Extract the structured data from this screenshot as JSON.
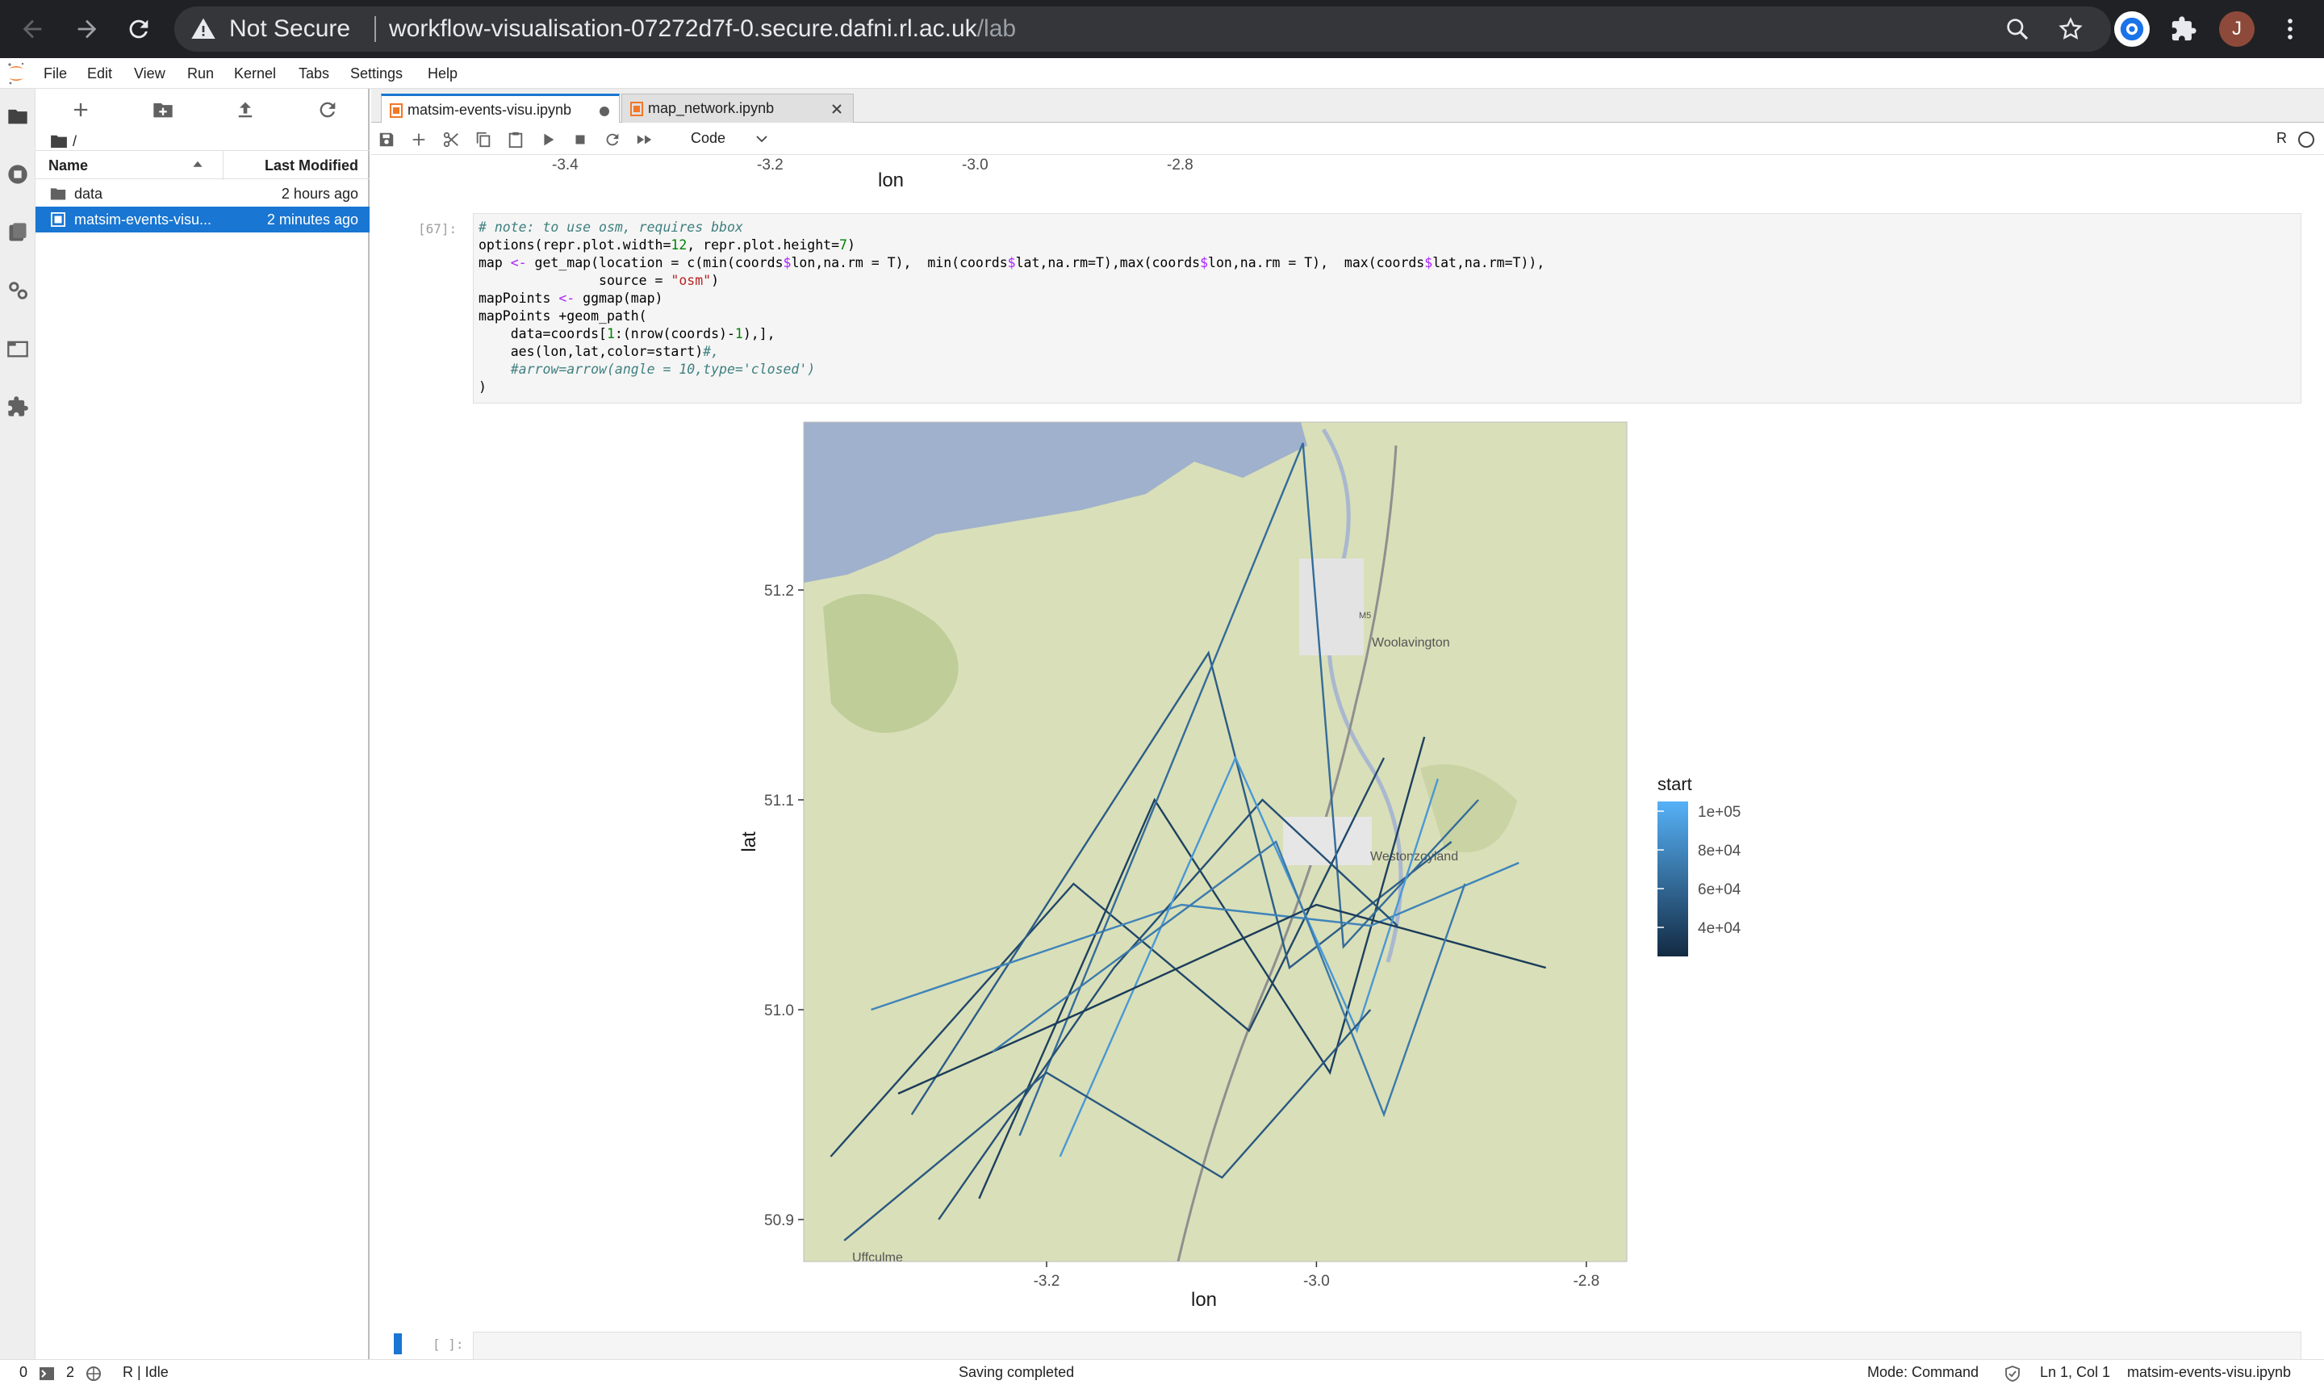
{
  "browser": {
    "security_label": "Not Secure",
    "url_host": "workflow-visualisation-07272d7f-0.secure.dafni.rl.ac.uk",
    "url_path": "/lab",
    "profile_initial": "J"
  },
  "menubar": {
    "items": [
      "File",
      "Edit",
      "View",
      "Run",
      "Kernel",
      "Tabs",
      "Settings",
      "Help"
    ]
  },
  "filebrowser": {
    "breadcrumb": "/",
    "header_name": "Name",
    "header_modified": "Last Modified",
    "rows": [
      {
        "name": "data",
        "modified": "2 hours ago",
        "type": "folder"
      },
      {
        "name": "matsim-events-visu...",
        "modified": "2 minutes ago",
        "type": "notebook"
      }
    ]
  },
  "tabs": [
    {
      "label": "matsim-events-visu.ipynb",
      "active": true,
      "dirty": true
    },
    {
      "label": "map_network.ipynb",
      "active": false,
      "dirty": false
    }
  ],
  "notebook_toolbar": {
    "cell_type": "Code",
    "kernel_name": "R"
  },
  "previous_output": {
    "x_ticks": [
      "-3.4",
      "-3.2",
      "-3.0",
      "-2.8"
    ],
    "x_label": "lon"
  },
  "cell": {
    "prompt": "[67]:",
    "code_lines": [
      "# note: to use osm, requires bbox",
      "options(repr.plot.width=12, repr.plot.height=7)",
      "map <- get_map(location = c(min(coords$lon,na.rm = T),  min(coords$lat,na.rm=T),max(coords$lon,na.rm = T),  max(coords$lat,na.rm=T)),",
      "               source = \"osm\")",
      "mapPoints <- ggmap(map)",
      "mapPoints +geom_path(",
      "    data=coords[1:(nrow(coords)-1),],",
      "    aes(lon,lat,color=start)#,",
      "    #arrow=arrow(angle = 10,type='closed')",
      ")"
    ]
  },
  "chart_data": {
    "type": "line",
    "title": "",
    "xlabel": "lon",
    "ylabel": "lat",
    "xlim": [
      -3.38,
      -2.77
    ],
    "ylim": [
      50.88,
      51.28
    ],
    "x_ticks": [
      "-3.2",
      "-3.0",
      "-2.8"
    ],
    "y_ticks": [
      "50.9",
      "51.0",
      "51.1",
      "51.2"
    ],
    "legend": {
      "title": "start",
      "labels": [
        "1e+05",
        "8e+04",
        "6e+04",
        "4e+04"
      ],
      "values": [
        100000,
        80000,
        60000,
        40000
      ],
      "color_low": "#132b43",
      "color_high": "#56b1f7",
      "range": [
        25000,
        105000
      ]
    },
    "map_labels": [
      "Woolavington",
      "Westonzoyland",
      "Uffculme",
      "M5"
    ],
    "series": [
      {
        "values": [
          [
            -3.36,
            50.93
          ],
          [
            -3.18,
            51.06
          ],
          [
            -3.05,
            50.99
          ],
          [
            -2.95,
            51.12
          ]
        ],
        "start": 42000
      },
      {
        "values": [
          [
            -3.3,
            50.95
          ],
          [
            -3.08,
            51.17
          ],
          [
            -3.02,
            51.02
          ],
          [
            -2.9,
            51.08
          ]
        ],
        "start": 55000
      },
      {
        "values": [
          [
            -3.25,
            50.91
          ],
          [
            -3.12,
            51.1
          ],
          [
            -2.99,
            50.97
          ],
          [
            -2.92,
            51.13
          ]
        ],
        "start": 38000
      },
      {
        "values": [
          [
            -3.33,
            51.0
          ],
          [
            -3.1,
            51.05
          ],
          [
            -2.96,
            51.04
          ],
          [
            -2.85,
            51.07
          ]
        ],
        "start": 78000
      },
      {
        "values": [
          [
            -3.22,
            50.94
          ],
          [
            -3.01,
            51.27
          ],
          [
            -2.98,
            51.03
          ],
          [
            -2.88,
            51.1
          ]
        ],
        "start": 64000
      },
      {
        "values": [
          [
            -3.28,
            50.9
          ],
          [
            -3.15,
            51.02
          ],
          [
            -3.04,
            51.1
          ],
          [
            -2.94,
            51.04
          ]
        ],
        "start": 47000
      },
      {
        "values": [
          [
            -3.19,
            50.93
          ],
          [
            -3.06,
            51.12
          ],
          [
            -2.97,
            50.99
          ],
          [
            -2.91,
            51.11
          ]
        ],
        "start": 90000
      },
      {
        "values": [
          [
            -3.31,
            50.96
          ],
          [
            -3.17,
            51.0
          ],
          [
            -3.0,
            51.05
          ],
          [
            -2.83,
            51.02
          ]
        ],
        "start": 35000
      },
      {
        "values": [
          [
            -3.24,
            50.98
          ],
          [
            -3.03,
            51.08
          ],
          [
            -2.95,
            50.95
          ],
          [
            -2.89,
            51.06
          ]
        ],
        "start": 72000
      },
      {
        "values": [
          [
            -3.35,
            50.89
          ],
          [
            -3.2,
            50.97
          ],
          [
            -3.07,
            50.92
          ],
          [
            -2.96,
            51.0
          ]
        ],
        "start": 52000
      }
    ]
  },
  "next_cell": {
    "prompt": "[ ]:"
  },
  "statusbar": {
    "terminals": "0",
    "kernels": "2",
    "kernel_status": "R | Idle",
    "message": "Saving completed",
    "mode": "Mode: Command",
    "position": "Ln 1, Col 1",
    "filename": "matsim-events-visu.ipynb"
  },
  "colors": {
    "accent": "#1976d2",
    "chrome_bg": "#202124",
    "editor_bg": "#f5f5f5"
  }
}
